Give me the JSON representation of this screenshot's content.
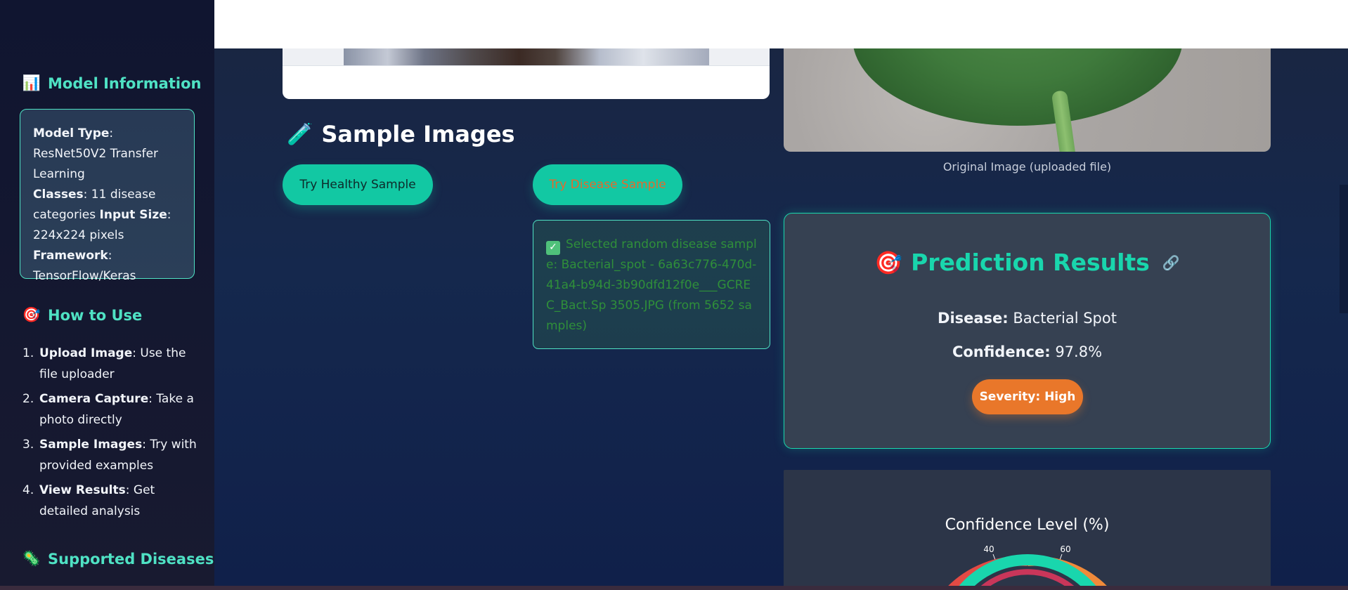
{
  "sidebar": {
    "model_info": {
      "icon": "bar-chart-icon",
      "title": "Model Information",
      "rows": [
        {
          "label": "Model Type",
          "value": ": ResNet50V2 Transfer Learning"
        },
        {
          "label": "Classes",
          "value": ": 11 disease categories "
        },
        {
          "label": "Input Size",
          "value": ": 224x224 pixels"
        },
        {
          "label": "Framework",
          "value": ": TensorFlow/Keras"
        }
      ]
    },
    "how_to": {
      "icon": "target-icon",
      "title": "How to Use",
      "steps": [
        {
          "num": "1.",
          "label": "Upload Image",
          "text": ": Use the file uploader"
        },
        {
          "num": "2.",
          "label": "Camera Capture",
          "text": ": Take a photo directly"
        },
        {
          "num": "3.",
          "label": "Sample Images",
          "text": ": Try with provided examples"
        },
        {
          "num": "4.",
          "label": "View Results",
          "text": ": Get detailed analysis"
        }
      ]
    },
    "supported": {
      "icon": "bug-icon",
      "title": "Supported Diseases"
    }
  },
  "samples": {
    "icon": "test-tube-icon",
    "title": "Sample Images",
    "healthy_button": "Try Healthy Sample",
    "disease_button": "Try Disease Sample",
    "message": "Selected random disease sample: Bacterial_spot - 6a63c776-470d-41a4-b94d-3b90dfd12f0e___GCREC_Bact.Sp 3505.JPG (from 5652 samples)"
  },
  "original": {
    "caption": "Original Image (uploaded file)"
  },
  "prediction": {
    "icon": "target-icon",
    "title": "Prediction Results",
    "disease_label": "Disease:",
    "disease_value": "Bacterial Spot",
    "confidence_label": "Confidence:",
    "confidence_value": "97.8%",
    "severity": "Severity: High"
  },
  "gauge": {
    "title": "Confidence Level (%)",
    "ticks": [
      "40",
      "60"
    ],
    "value_percent": 97.8
  },
  "colors": {
    "accent": "#19d6ad",
    "severity": "#e9772a"
  }
}
